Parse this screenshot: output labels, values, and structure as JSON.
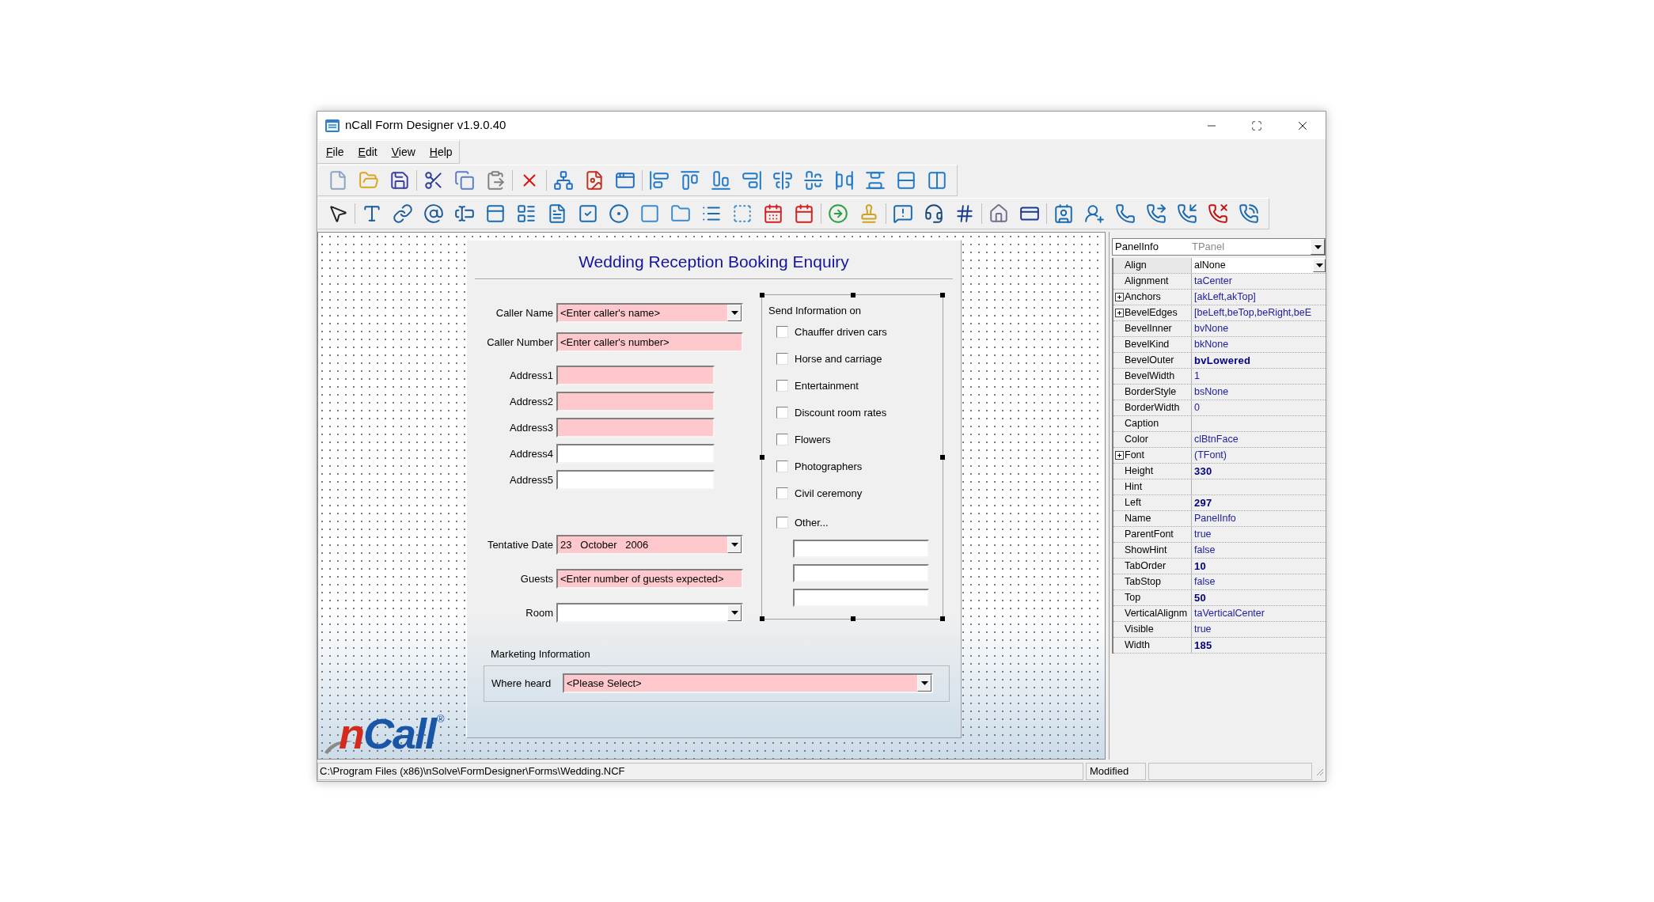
{
  "window": {
    "title": "nCall Form Designer v1.9.0.40"
  },
  "menu": [
    {
      "label": "File"
    },
    {
      "label": "Edit"
    },
    {
      "label": "View"
    },
    {
      "label": "Help"
    }
  ],
  "form": {
    "title": "Wedding Reception Booking Enquiry",
    "field_groups": [
      [
        {
          "label": "Caller Name",
          "kind": "combo",
          "value": "<Enter caller's name>",
          "required": true
        },
        {
          "label": "Caller Number",
          "kind": "text",
          "value": "<Enter caller's number>",
          "required": true
        }
      ],
      [
        {
          "label": "Address1",
          "kind": "text",
          "required": true
        },
        {
          "label": "Address2",
          "kind": "text",
          "required": true
        },
        {
          "label": "Address3",
          "kind": "text",
          "required": true
        },
        {
          "label": "Address4",
          "kind": "text",
          "required": false
        },
        {
          "label": "Address5",
          "kind": "text",
          "required": false
        }
      ],
      [
        {
          "label": "Tentative Date",
          "kind": "combo",
          "value": "23   October   2006",
          "required": true
        },
        {
          "label": "Guests",
          "kind": "text",
          "value": "<Enter number of guests expected>",
          "required": true
        },
        {
          "label": "Room",
          "kind": "combo",
          "required": false
        }
      ]
    ],
    "send_info": {
      "title": "Send Information on",
      "selected": true,
      "items": [
        {
          "label": "Chauffer driven cars",
          "checked": false
        },
        {
          "label": "Horse and carriage",
          "checked": false
        },
        {
          "label": "Entertainment",
          "checked": false
        },
        {
          "label": "Discount room rates",
          "checked": false
        },
        {
          "label": "Flowers",
          "checked": false
        },
        {
          "label": "Photographers",
          "checked": false
        },
        {
          "label": "Civil ceremony",
          "checked": false
        },
        {
          "label": "Other...",
          "checked": false
        }
      ]
    },
    "marketing": {
      "title": "Marketing Information",
      "field": {
        "label": "Where heard",
        "kind": "combo",
        "value": "<Please Select>",
        "required": true
      }
    }
  },
  "logo": {
    "initial": "n",
    "name": "Call",
    "mark": "®"
  },
  "inspector": {
    "component": "PanelInfo",
    "type": "TPanel",
    "rows": [
      {
        "name": "Align",
        "value": "alNone",
        "selected": true,
        "expandable": false,
        "modified": false
      },
      {
        "name": "Alignment",
        "value": "taCenter",
        "selected": false,
        "expandable": false,
        "modified": false
      },
      {
        "name": "Anchors",
        "value": "[akLeft,akTop]",
        "selected": false,
        "expandable": true,
        "modified": false
      },
      {
        "name": "BevelEdges",
        "value": "[beLeft,beTop,beRight,beE",
        "selected": false,
        "expandable": true,
        "modified": false
      },
      {
        "name": "BevelInner",
        "value": "bvNone",
        "selected": false,
        "expandable": false,
        "modified": false
      },
      {
        "name": "BevelKind",
        "value": "bkNone",
        "selected": false,
        "expandable": false,
        "modified": false
      },
      {
        "name": "BevelOuter",
        "value": "bvLowered",
        "selected": false,
        "expandable": false,
        "modified": true
      },
      {
        "name": "BevelWidth",
        "value": "1",
        "selected": false,
        "expandable": false,
        "modified": false
      },
      {
        "name": "BorderStyle",
        "value": "bsNone",
        "selected": false,
        "expandable": false,
        "modified": false
      },
      {
        "name": "BorderWidth",
        "value": "0",
        "selected": false,
        "expandable": false,
        "modified": false
      },
      {
        "name": "Caption",
        "selected": false,
        "expandable": false,
        "modified": false
      },
      {
        "name": "Color",
        "value": "clBtnFace",
        "selected": false,
        "expandable": false,
        "modified": false
      },
      {
        "name": "Font",
        "value": "(TFont)",
        "selected": false,
        "expandable": true,
        "modified": false
      },
      {
        "name": "Height",
        "value": "330",
        "selected": false,
        "expandable": false,
        "modified": true
      },
      {
        "name": "Hint",
        "selected": false,
        "expandable": false,
        "modified": false
      },
      {
        "name": "Left",
        "value": "297",
        "selected": false,
        "expandable": false,
        "modified": true
      },
      {
        "name": "Name",
        "value": "PanelInfo",
        "selected": false,
        "expandable": false,
        "modified": false
      },
      {
        "name": "ParentFont",
        "value": "true",
        "selected": false,
        "expandable": false,
        "modified": false
      },
      {
        "name": "ShowHint",
        "value": "false",
        "selected": false,
        "expandable": false,
        "modified": false
      },
      {
        "name": "TabOrder",
        "value": "10",
        "selected": false,
        "expandable": false,
        "modified": true
      },
      {
        "name": "TabStop",
        "value": "false",
        "selected": false,
        "expandable": false,
        "modified": false
      },
      {
        "name": "Top",
        "value": "50",
        "selected": false,
        "expandable": false,
        "modified": true
      },
      {
        "name": "VerticalAlignm",
        "value": "taVerticalCenter",
        "selected": false,
        "expandable": false,
        "modified": false
      },
      {
        "name": "Visible",
        "value": "true",
        "selected": false,
        "expandable": false,
        "modified": false
      },
      {
        "name": "Width",
        "value": "185",
        "selected": false,
        "expandable": false,
        "modified": true
      }
    ]
  },
  "status_bar": {
    "path": "C:\\Program Files (x86)\\nSolve\\FormDesigner\\Forms\\Wedding.NCF",
    "state": "Modified"
  }
}
